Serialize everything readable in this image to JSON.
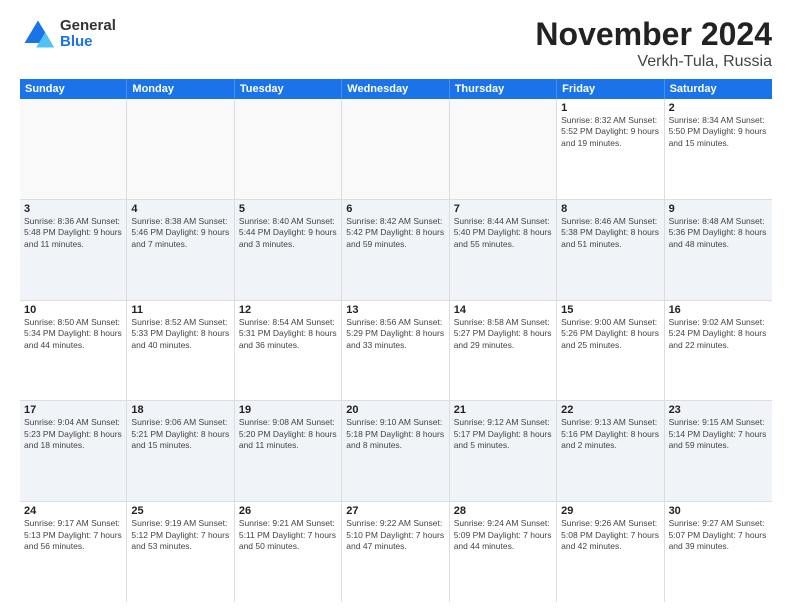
{
  "logo": {
    "general": "General",
    "blue": "Blue"
  },
  "title": "November 2024",
  "subtitle": "Verkh-Tula, Russia",
  "header_days": [
    "Sunday",
    "Monday",
    "Tuesday",
    "Wednesday",
    "Thursday",
    "Friday",
    "Saturday"
  ],
  "weeks": [
    [
      {
        "day": "",
        "info": ""
      },
      {
        "day": "",
        "info": ""
      },
      {
        "day": "",
        "info": ""
      },
      {
        "day": "",
        "info": ""
      },
      {
        "day": "",
        "info": ""
      },
      {
        "day": "1",
        "info": "Sunrise: 8:32 AM\nSunset: 5:52 PM\nDaylight: 9 hours and 19 minutes."
      },
      {
        "day": "2",
        "info": "Sunrise: 8:34 AM\nSunset: 5:50 PM\nDaylight: 9 hours and 15 minutes."
      }
    ],
    [
      {
        "day": "3",
        "info": "Sunrise: 8:36 AM\nSunset: 5:48 PM\nDaylight: 9 hours and 11 minutes."
      },
      {
        "day": "4",
        "info": "Sunrise: 8:38 AM\nSunset: 5:46 PM\nDaylight: 9 hours and 7 minutes."
      },
      {
        "day": "5",
        "info": "Sunrise: 8:40 AM\nSunset: 5:44 PM\nDaylight: 9 hours and 3 minutes."
      },
      {
        "day": "6",
        "info": "Sunrise: 8:42 AM\nSunset: 5:42 PM\nDaylight: 8 hours and 59 minutes."
      },
      {
        "day": "7",
        "info": "Sunrise: 8:44 AM\nSunset: 5:40 PM\nDaylight: 8 hours and 55 minutes."
      },
      {
        "day": "8",
        "info": "Sunrise: 8:46 AM\nSunset: 5:38 PM\nDaylight: 8 hours and 51 minutes."
      },
      {
        "day": "9",
        "info": "Sunrise: 8:48 AM\nSunset: 5:36 PM\nDaylight: 8 hours and 48 minutes."
      }
    ],
    [
      {
        "day": "10",
        "info": "Sunrise: 8:50 AM\nSunset: 5:34 PM\nDaylight: 8 hours and 44 minutes."
      },
      {
        "day": "11",
        "info": "Sunrise: 8:52 AM\nSunset: 5:33 PM\nDaylight: 8 hours and 40 minutes."
      },
      {
        "day": "12",
        "info": "Sunrise: 8:54 AM\nSunset: 5:31 PM\nDaylight: 8 hours and 36 minutes."
      },
      {
        "day": "13",
        "info": "Sunrise: 8:56 AM\nSunset: 5:29 PM\nDaylight: 8 hours and 33 minutes."
      },
      {
        "day": "14",
        "info": "Sunrise: 8:58 AM\nSunset: 5:27 PM\nDaylight: 8 hours and 29 minutes."
      },
      {
        "day": "15",
        "info": "Sunrise: 9:00 AM\nSunset: 5:26 PM\nDaylight: 8 hours and 25 minutes."
      },
      {
        "day": "16",
        "info": "Sunrise: 9:02 AM\nSunset: 5:24 PM\nDaylight: 8 hours and 22 minutes."
      }
    ],
    [
      {
        "day": "17",
        "info": "Sunrise: 9:04 AM\nSunset: 5:23 PM\nDaylight: 8 hours and 18 minutes."
      },
      {
        "day": "18",
        "info": "Sunrise: 9:06 AM\nSunset: 5:21 PM\nDaylight: 8 hours and 15 minutes."
      },
      {
        "day": "19",
        "info": "Sunrise: 9:08 AM\nSunset: 5:20 PM\nDaylight: 8 hours and 11 minutes."
      },
      {
        "day": "20",
        "info": "Sunrise: 9:10 AM\nSunset: 5:18 PM\nDaylight: 8 hours and 8 minutes."
      },
      {
        "day": "21",
        "info": "Sunrise: 9:12 AM\nSunset: 5:17 PM\nDaylight: 8 hours and 5 minutes."
      },
      {
        "day": "22",
        "info": "Sunrise: 9:13 AM\nSunset: 5:16 PM\nDaylight: 8 hours and 2 minutes."
      },
      {
        "day": "23",
        "info": "Sunrise: 9:15 AM\nSunset: 5:14 PM\nDaylight: 7 hours and 59 minutes."
      }
    ],
    [
      {
        "day": "24",
        "info": "Sunrise: 9:17 AM\nSunset: 5:13 PM\nDaylight: 7 hours and 56 minutes."
      },
      {
        "day": "25",
        "info": "Sunrise: 9:19 AM\nSunset: 5:12 PM\nDaylight: 7 hours and 53 minutes."
      },
      {
        "day": "26",
        "info": "Sunrise: 9:21 AM\nSunset: 5:11 PM\nDaylight: 7 hours and 50 minutes."
      },
      {
        "day": "27",
        "info": "Sunrise: 9:22 AM\nSunset: 5:10 PM\nDaylight: 7 hours and 47 minutes."
      },
      {
        "day": "28",
        "info": "Sunrise: 9:24 AM\nSunset: 5:09 PM\nDaylight: 7 hours and 44 minutes."
      },
      {
        "day": "29",
        "info": "Sunrise: 9:26 AM\nSunset: 5:08 PM\nDaylight: 7 hours and 42 minutes."
      },
      {
        "day": "30",
        "info": "Sunrise: 9:27 AM\nSunset: 5:07 PM\nDaylight: 7 hours and 39 minutes."
      }
    ]
  ]
}
